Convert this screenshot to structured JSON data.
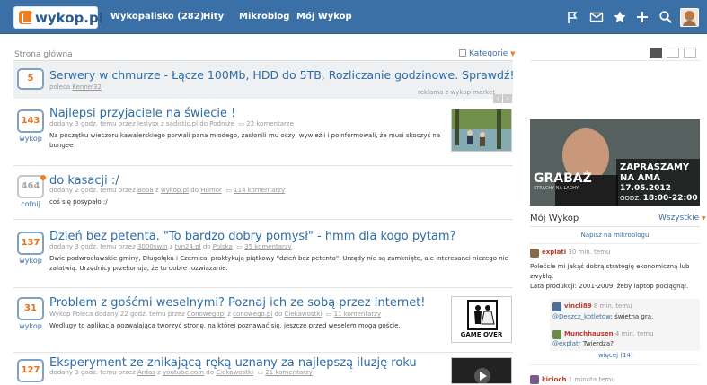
{
  "header": {
    "logo_text": "wykop.pl",
    "nav": [
      {
        "label": "Wykopalisko (282)"
      },
      {
        "label": "Hity"
      },
      {
        "label": "Mikroblog"
      },
      {
        "label": "Mój Wykop"
      }
    ],
    "icons": [
      "flag-icon",
      "mail-icon",
      "star-icon",
      "plus-icon",
      "search-icon"
    ]
  },
  "breadcrumb": "Strona główna",
  "kategorie_label": "Kategorie",
  "ad": {
    "votes": "5",
    "title": "Serwery w chmurze - Łącze 100Mb, HDD do 5TB, Rozliczanie godzinowe. Sprawdź!",
    "meta": "poleca",
    "meta_user": "Kennel32",
    "footer": "reklama z wykop market"
  },
  "posts": [
    {
      "votes": "143",
      "button": "wykop",
      "title": "Najlepsi przyjaciele na świecie !",
      "meta_prefix": "dodany 3 godz. temu przez",
      "user": "leslysx",
      "via": "z",
      "source": "sadistic.pl",
      "cat_prefix": "do",
      "category": "Podróże",
      "comments": "22 komentarze",
      "desc": "Na początku wieczoru kawalerskiego porwali pana młodego, zasłonili mu oczy, wywieźli i poinformowali, że musi skoczyć na bungee"
    },
    {
      "votes": "464",
      "button": "cofnij",
      "title": "do kasacji :/",
      "meta_prefix": "dodany 2 godz. temu przez",
      "user": "Boo8",
      "via": "z",
      "source": "wykop.pl",
      "cat_prefix": "do",
      "category": "Humor",
      "comments": "114 komentarzy",
      "desc": "coś się posypało :/"
    },
    {
      "votes": "137",
      "button": "wykop",
      "title": "Dzień bez petenta. \"To bardzo dobry pomysł\" - hmm dla kogo pytam?",
      "meta_prefix": "dodany 3 godz. temu przez",
      "user": "3000swin",
      "via": "z",
      "source": "tvn24.pl",
      "cat_prefix": "do",
      "category": "Polska",
      "comments": "35 komentarzy",
      "desc": "Dwie podwrocławskie gminy, Długołęka i Czernica, praktykują piątkowy \"dzień bez petenta\". Urzędy nie są zamknięte, ale interesanci niczego nie załatwią. Urzędnicy przekonują, że to dobre rozwiązanie."
    },
    {
      "votes": "31",
      "button": "wykop",
      "title": "Problem z gośćmi weselnymi? Poznaj ich ze sobą przez Internet!",
      "meta_prefix": "Wykop Poleca dodany 22 godz. temu przez",
      "user": "Conowegopl",
      "via": "z",
      "source": "conowego.pl",
      "cat_prefix": "do",
      "category": "Ciekawostki",
      "comments": "11 komentarzy",
      "desc": "Wedlugy to aplikacja pozwalająca tworzyć stronę, na której poznawać się, jeszcze przed weselem mogą goście.",
      "thumb_caption": "GAME OVER"
    },
    {
      "votes": "127",
      "button": "wykop",
      "title": "Eksperyment ze znikającą ręką uznany za najlepszą iluzję roku",
      "meta_prefix": "dodany 3 godz. temu przez",
      "user": "Ardas",
      "via": "z",
      "source": "youtube.com",
      "cat_prefix": "do",
      "category": "Ciekawostki",
      "comments": "21 komentarzy",
      "desc": ""
    }
  ],
  "sidebar": {
    "banner": {
      "brand": "GRABAŻ",
      "brand_sub": "STRACHY NA LACHY",
      "line1": "ZAPRASZAMY",
      "line2": "NA AMA",
      "date": "17.05.2012",
      "time_prefix": "GODZ.",
      "time": "18:00-22:00"
    },
    "title": "Mój Wykop",
    "wszystkie": "Wszystkie",
    "napisz": "Napisz na mikroblogu",
    "entries": [
      {
        "name": "explati",
        "time": "30 min. temu",
        "text": "Polećcie mi jakąś dobrą strategię ekonomiczną lub zwykłą.",
        "text2": "Lata produkcji: 2001-2009, żeby laptop pociągnął."
      },
      {
        "name": "vincli89",
        "time": "8 min. temu",
        "tag": "@Deszcz_kotletow",
        "text": ": świetna gra."
      },
      {
        "name": "Munchhausen",
        "time": "4 min. temu",
        "tag": "@explatr",
        "text": " Twierdza?"
      }
    ],
    "wiecej": "więcej (14)",
    "last_name": "kicioch",
    "last_time": "1 minuta temu"
  },
  "colors": {
    "topbar": "#3b70a6",
    "accent": "#f07e21",
    "link": "#2c6ca8"
  }
}
